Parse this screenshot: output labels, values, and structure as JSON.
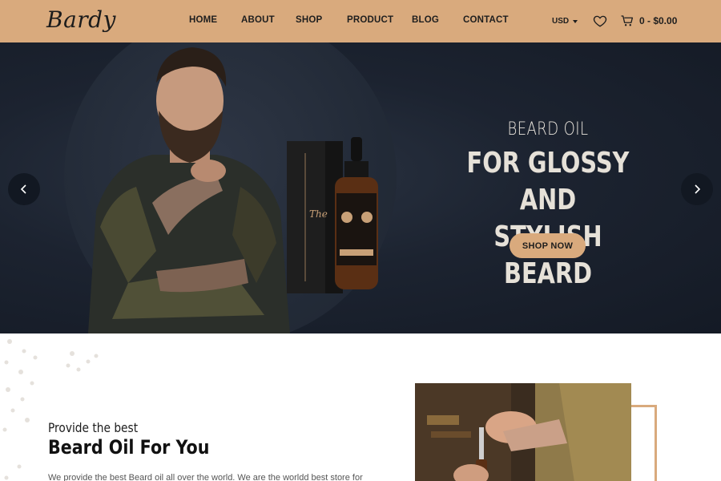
{
  "brand": {
    "logo_text": "Bardy"
  },
  "nav": {
    "items": [
      {
        "label": "HOME"
      },
      {
        "label": "ABOUT"
      },
      {
        "label": "SHOP"
      },
      {
        "label": "PRODUCT"
      },
      {
        "label": "BLOG"
      },
      {
        "label": "CONTACT"
      }
    ]
  },
  "header_tools": {
    "currency": "USD",
    "wishlist_icon": "heart-icon",
    "cart_icon": "cart-icon",
    "cart_summary": "0 - $0.00"
  },
  "hero": {
    "kicker": "BEARD OIL",
    "title_line1": "FOR GLOSSY AND",
    "title_line2": "STYLISH BEARD",
    "cta_label": "SHOP NOW",
    "prev_icon": "chevron-left-icon",
    "next_icon": "chevron-right-icon"
  },
  "about": {
    "kicker": "Provide the best",
    "title": "Beard Oil For You",
    "text": "We provide the best Beard oil all over the world. We are the worldd best store for"
  },
  "colors": {
    "accent": "#d9aa7d",
    "hero_bg": "#1c2330",
    "text_dark": "#1e1e1e"
  }
}
